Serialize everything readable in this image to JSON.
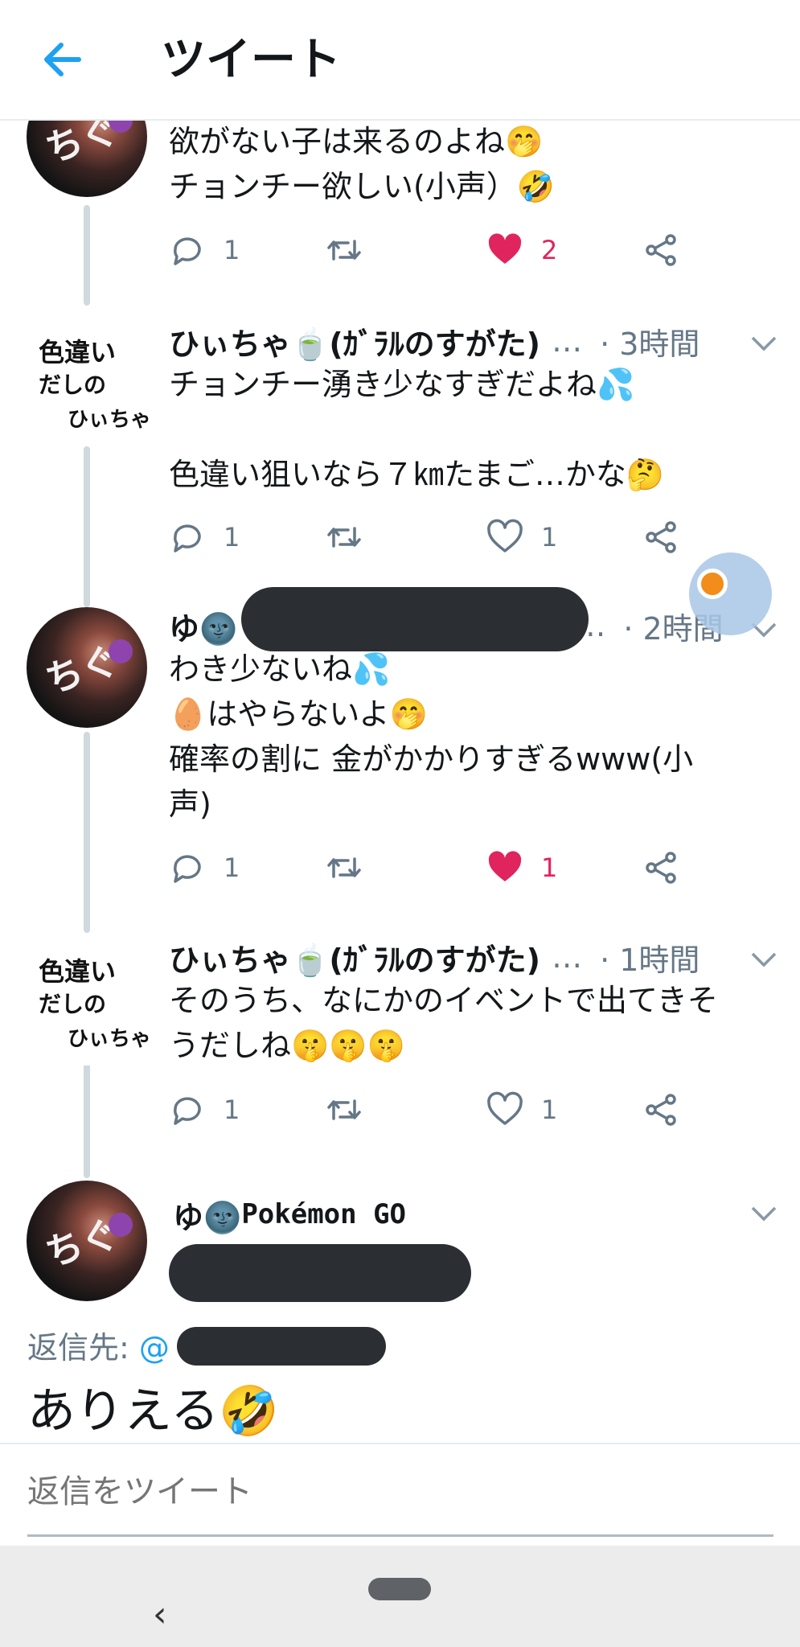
{
  "header": {
    "title": "ツイート"
  },
  "tweets": [
    {
      "text": "欲がない子は来るのよね🤭\nチョンチー欲しい(小声）🤣",
      "reply_count": "1",
      "like_count": "2",
      "liked": true
    },
    {
      "name": "ひぃちゃ🍵(ｶﾞﾗﾙのすがた)",
      "ellipsis": "…",
      "time": "· 3時間",
      "text": "チョンチー湧き少なすぎだよね💦\n\n色違い狙いなら７㎞たまご…かな🤔",
      "reply_count": "1",
      "like_count": "1",
      "liked": false,
      "avatar_text": [
        "色違い",
        "だしの",
        "ひぃちゃ"
      ]
    },
    {
      "name": "ゆ🌚",
      "ellipsis": "…",
      "time": "· 2時間",
      "text": "わき少ないね💦\n🥚はやらないよ🤭\n確率の割に 金がかかりすぎるwww(小\n声)",
      "reply_count": "1",
      "like_count": "1",
      "liked": true
    },
    {
      "name": "ひぃちゃ🍵(ｶﾞﾗﾙのすがた)",
      "ellipsis": "…",
      "time": "· 1時間",
      "text": "そのうち、なにかのイベントで出てきそ\nうだしね🤫🤫🤫",
      "reply_count": "1",
      "like_count": "1",
      "liked": false,
      "avatar_text": [
        "色違い",
        "だしの",
        "ひぃちゃ"
      ]
    }
  ],
  "main_tweet": {
    "name": "ゆ🌚",
    "name_suffix": "Pokémon GO",
    "reply_label": "返信先:",
    "reply_at": "@",
    "text": "ありえる🤣"
  },
  "composer": {
    "placeholder": "返信をツイート"
  },
  "navbar": {
    "back_glyph": "‹"
  },
  "colors": {
    "like": "#e0245e",
    "link": "#1da1f2",
    "muted": "#657786",
    "redaction": "#2b2f33"
  }
}
